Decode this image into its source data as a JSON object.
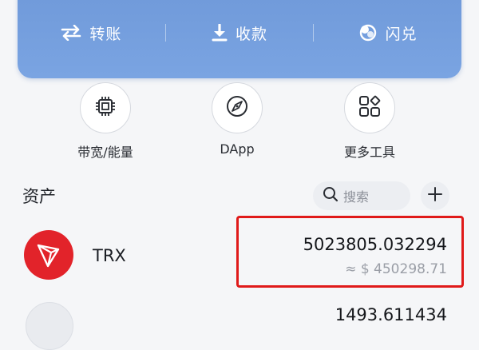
{
  "actions": {
    "transfer_label": "转账",
    "receive_label": "收款",
    "swap_label": "闪兑"
  },
  "tools": [
    {
      "label": "带宽/能量",
      "icon": "chip-icon"
    },
    {
      "label": "DApp",
      "icon": "compass-icon"
    },
    {
      "label": "更多工具",
      "icon": "grid-icon"
    }
  ],
  "assets": {
    "title": "资产",
    "search_placeholder": "搜索",
    "items": [
      {
        "symbol": "TRX",
        "amount": "5023805.032294",
        "fiat": "≈ $ 450298.71",
        "logo_color": "#e2232a"
      },
      {
        "symbol": "",
        "amount": "1493.611434",
        "fiat": ""
      }
    ]
  },
  "colors": {
    "card": "#7aa4e2",
    "highlight": "#e01a1a",
    "trx": "#e2232a"
  }
}
